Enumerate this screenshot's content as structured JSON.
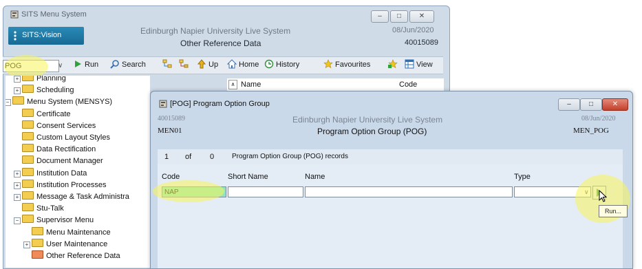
{
  "main_window": {
    "title": "SITS Menu System",
    "logo_text": "SITS:Vision",
    "system_name": "Edinburgh Napier University Live System",
    "screen_name": "Other Reference Data",
    "date": "08/Jun/2020",
    "user_id": "40015089",
    "min_icon": "minimize-icon",
    "max_icon": "maximize-icon",
    "close_icon": "close-icon"
  },
  "toolbar": {
    "search_value": "POG",
    "run": "Run",
    "search": "Search",
    "up": "Up",
    "home": "Home",
    "history": "History",
    "favourites": "Favourites",
    "view": "View"
  },
  "tree": {
    "items": [
      {
        "label": "Planning",
        "expander": "+"
      },
      {
        "label": "Scheduling",
        "expander": "+"
      },
      {
        "label": "Menu System (MENSYS)",
        "expander": "−"
      },
      {
        "label": "Certificate"
      },
      {
        "label": "Consent Services"
      },
      {
        "label": "Custom Layout Styles"
      },
      {
        "label": "Data Rectification"
      },
      {
        "label": "Document Manager"
      },
      {
        "label": "Institution Data",
        "expander": "+"
      },
      {
        "label": "Institution Processes",
        "expander": "+"
      },
      {
        "label": "Message & Task Administra",
        "expander": "+"
      },
      {
        "label": "Stu-Talk"
      },
      {
        "label": "Supervisor Menu",
        "expander": "−"
      },
      {
        "label": "Menu Maintenance"
      },
      {
        "label": "User Maintenance",
        "expander": "+"
      },
      {
        "label": "Other Reference Data"
      }
    ]
  },
  "list": {
    "col_name": "Name",
    "col_code": "Code"
  },
  "dialog": {
    "title": "[POG] Program Option Group",
    "user_id": "40015089",
    "system_name": "Edinburgh Napier University Live System",
    "date": "08/Jun/2020",
    "menu_code": "MEN01",
    "screen_name": "Program Option Group (POG)",
    "screen_code": "MEN_POG",
    "record_current": "1",
    "record_of": "of",
    "record_total": "0",
    "record_label": "Program Option Group (POG) records",
    "fields": {
      "code_label": "Code",
      "code_value": "NAP",
      "short_name_label": "Short Name",
      "short_name_value": "",
      "name_label": "Name",
      "name_value": "",
      "type_label": "Type",
      "type_value": ""
    },
    "run_tooltip": "Run..."
  },
  "colors": {
    "highlight": "#f8f45a",
    "code_field_bg": "#8ee6c1",
    "logo_bg": "#1f7fae"
  }
}
